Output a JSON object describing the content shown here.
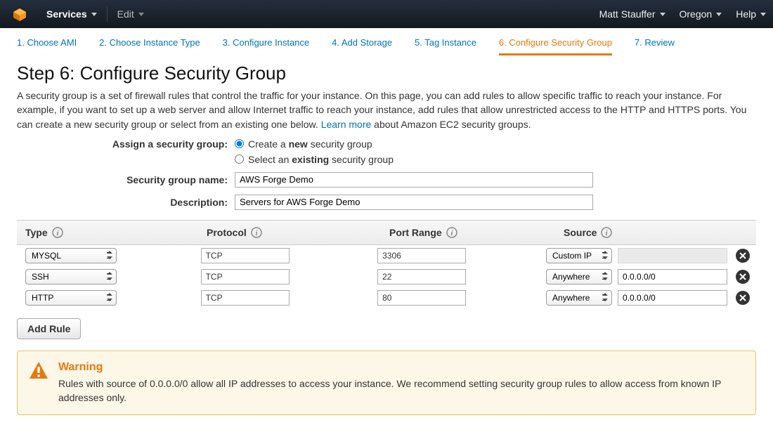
{
  "topnav": {
    "services": "Services",
    "edit": "Edit",
    "user": "Matt Stauffer",
    "region": "Oregon",
    "help": "Help"
  },
  "tabs": [
    {
      "label": "1. Choose AMI"
    },
    {
      "label": "2. Choose Instance Type"
    },
    {
      "label": "3. Configure Instance"
    },
    {
      "label": "4. Add Storage"
    },
    {
      "label": "5. Tag Instance"
    },
    {
      "label": "6. Configure Security Group",
      "active": true
    },
    {
      "label": "7. Review"
    }
  ],
  "page": {
    "title": "Step 6: Configure Security Group",
    "desc_a": "A security group is a set of firewall rules that control the traffic for your instance. On this page, you can add rules to allow specific traffic to reach your instance. For example, if you want to set up a web server and allow Internet traffic to reach your instance, add rules that allow unrestricted access to the HTTP and HTTPS ports. You can create a new security group or select from an existing one below. ",
    "learn_more": "Learn more",
    "desc_b": " about Amazon EC2 security groups."
  },
  "form": {
    "assign_label": "Assign a security group:",
    "radio_new_a": "Create a ",
    "radio_new_b": "new",
    "radio_new_c": " security group",
    "radio_existing_a": "Select an ",
    "radio_existing_b": "existing",
    "radio_existing_c": " security group",
    "name_label": "Security group name:",
    "name_value": "AWS Forge Demo",
    "desc_label": "Description:",
    "desc_value": "Servers for AWS Forge Demo"
  },
  "columns": {
    "type": "Type",
    "protocol": "Protocol",
    "port": "Port Range",
    "source": "Source"
  },
  "rows": [
    {
      "type": "MYSQL",
      "protocol": "TCP",
      "port": "3306",
      "source_mode": "Custom IP",
      "source_val": ""
    },
    {
      "type": "SSH",
      "protocol": "TCP",
      "port": "22",
      "source_mode": "Anywhere",
      "source_val": "0.0.0.0/0"
    },
    {
      "type": "HTTP",
      "protocol": "TCP",
      "port": "80",
      "source_mode": "Anywhere",
      "source_val": "0.0.0.0/0"
    }
  ],
  "add_rule": "Add Rule",
  "warning": {
    "title": "Warning",
    "msg": "Rules with source of 0.0.0.0/0 allow all IP addresses to access your instance. We recommend setting security group rules to allow access from known IP addresses only."
  }
}
